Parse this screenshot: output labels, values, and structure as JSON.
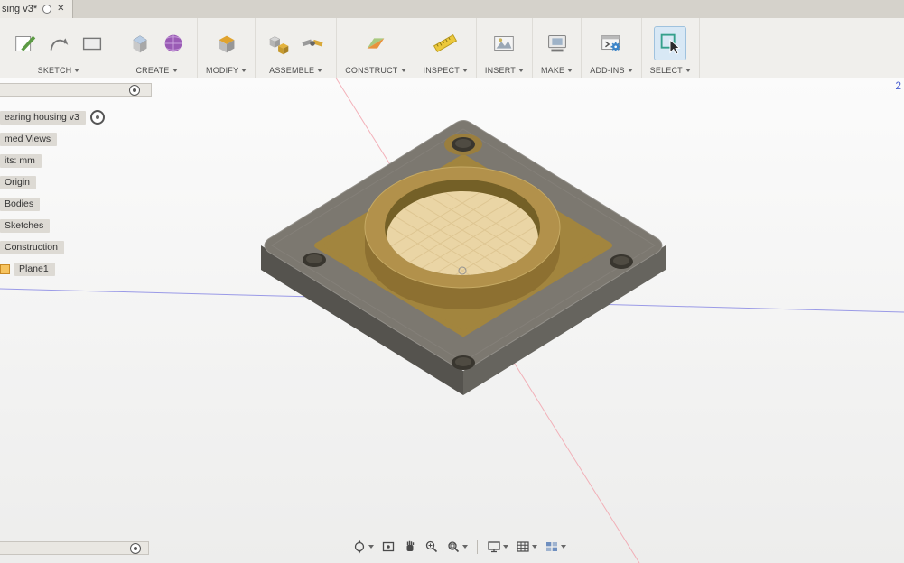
{
  "tab_bar": {
    "title": "sing v3*",
    "close_glyph": "✕"
  },
  "toolbar": {
    "groups": [
      {
        "label": "SKETCH"
      },
      {
        "label": "CREATE"
      },
      {
        "label": "MODIFY"
      },
      {
        "label": "ASSEMBLE"
      },
      {
        "label": "CONSTRUCT"
      },
      {
        "label": "INSPECT"
      },
      {
        "label": "INSERT"
      },
      {
        "label": "MAKE"
      },
      {
        "label": "ADD-INS"
      },
      {
        "label": "SELECT"
      }
    ]
  },
  "browser": {
    "root_label": "earing housing v3",
    "items": [
      {
        "label": "med Views"
      },
      {
        "label": "its: mm"
      },
      {
        "label": "Origin"
      },
      {
        "label": "Bodies"
      },
      {
        "label": "Sketches"
      },
      {
        "label": "Construction"
      },
      {
        "label": "Plane1"
      }
    ]
  },
  "viewport": {
    "corner_label": "2"
  },
  "colors": {
    "model_gold_rim": "#b2914b",
    "model_pocket": "#a2853e",
    "model_floor": "#ead5a5",
    "select_teal": "#35a08c",
    "axis_blue": "#6a6ae0",
    "axis_pink": "#f2a0aa"
  }
}
